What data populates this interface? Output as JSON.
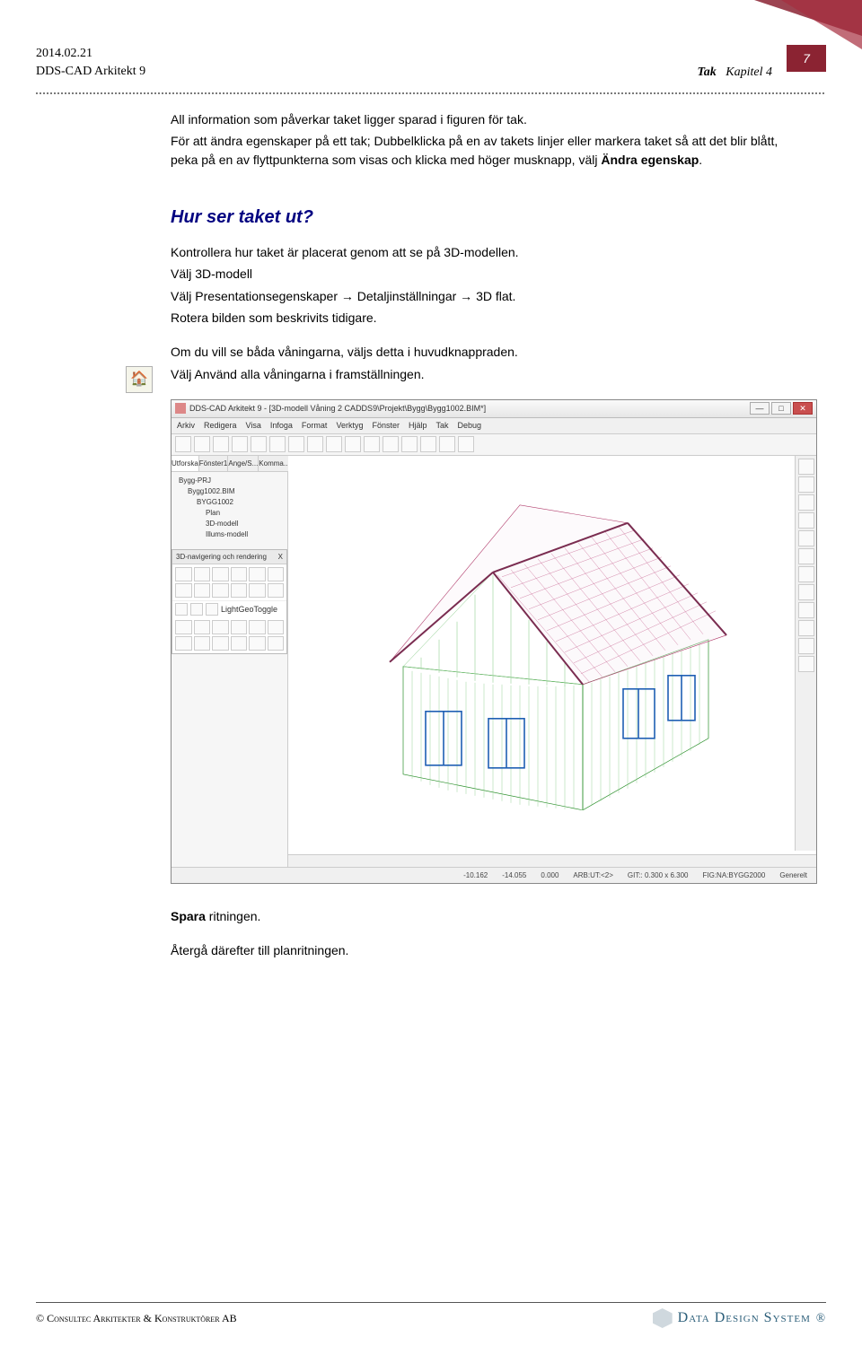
{
  "header": {
    "date": "2014.02.21",
    "product": "DDS-CAD Arkitekt 9",
    "section_bold": "Tak",
    "section_rest": "Kapitel 4",
    "page_number": "7"
  },
  "body": {
    "p1": "All information som påverkar taket ligger sparad i figuren för tak.",
    "p2_a": "För att ändra egenskaper på ett tak; Dubbelklicka på en av takets linjer eller markera taket så att det blir blått, peka på en av flyttpunkterna som visas och klicka med höger musknapp, välj ",
    "p2_b": "Ändra egenskap",
    "p2_c": ".",
    "heading": "Hur ser taket ut?",
    "p3": "Kontrollera hur taket är placerat genom att se på 3D-modellen.",
    "p4": "Välj 3D-modell",
    "p5": "Välj Presentationsegenskaper     → Detaljinställningar → 3D flat.",
    "p6": "Rotera bilden som beskrivits tidigare.",
    "p7": "Om du vill se båda våningarna, väljs detta i huvudknappraden.",
    "p8": "Välj Använd alla våningarna i framställningen.",
    "after1_a": "Spara",
    "after1_b": " ritningen.",
    "after2": "Återgå därefter till planritningen."
  },
  "screenshot": {
    "title": "DDS-CAD Arkitekt 9 - [3D-modell  Våning 2  CADDS9\\Projekt\\Bygg\\Bygg1002.BIM*]",
    "menus": [
      "Arkiv",
      "Redigera",
      "Visa",
      "Infoga",
      "Format",
      "Verktyg",
      "Fönster",
      "Hjälp",
      "Tak",
      "Debug"
    ],
    "left_tabs": [
      "Utforska",
      "Fönster1",
      "Ange/S...",
      "Komma..."
    ],
    "tree": {
      "a": "Bygg-PRJ",
      "b": "Bygg1002.BIM",
      "c": "BYGG1002",
      "d": "Plan",
      "e": "3D-modell",
      "f": "Illums-modell"
    },
    "palette_title": "3D-navigering och rendering",
    "palette_close": "X",
    "palette_label": "LightGeoToggle",
    "status": {
      "s1": "-10.162",
      "s2": "-14.055",
      "s3": "0.000",
      "s4": "ARB:UT:<2>",
      "s5": "GIT:: 0.300 x 6.300",
      "s6": "FIG:NA:BYGG2000",
      "s7": "Generelt"
    },
    "win_min": "—",
    "win_max": "□",
    "win_close": "✕"
  },
  "footer": {
    "left": "©  Consultec Arkitekter & Konstruktörer AB",
    "brand": "Data Design System",
    "reg": "®"
  }
}
